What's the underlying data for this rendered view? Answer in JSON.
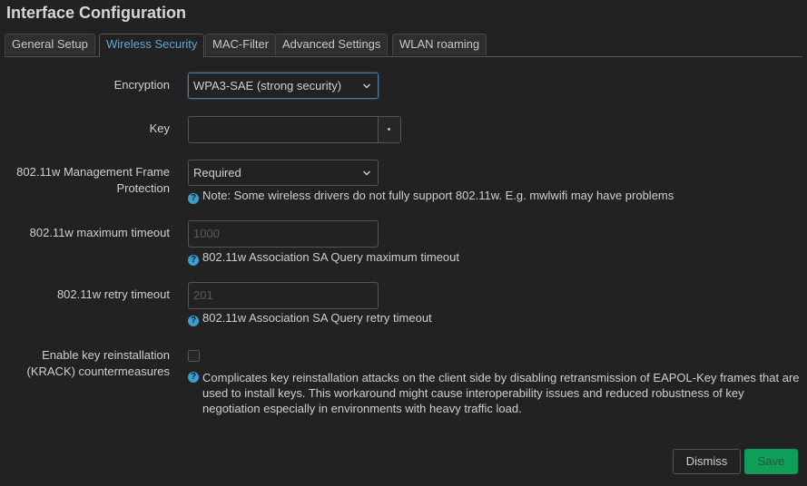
{
  "page": {
    "title": "Interface Configuration"
  },
  "tabs": [
    {
      "label": "General Setup",
      "active": false
    },
    {
      "label": "Wireless Security",
      "active": true
    },
    {
      "label": "MAC-Filter",
      "active": false
    },
    {
      "label": "Advanced Settings",
      "active": false
    },
    {
      "label": "WLAN roaming",
      "active": false
    }
  ],
  "form": {
    "encryption": {
      "label": "Encryption",
      "value": "WPA3-SAE (strong security)"
    },
    "key": {
      "label": "Key",
      "value": "",
      "reveal_button_icon": "dot-icon"
    },
    "mfp": {
      "label_line1": "802.11w Management Frame",
      "label_line2": "Protection",
      "value": "Required",
      "help": "Note: Some wireless drivers do not fully support 802.11w. E.g. mwlwifi may have problems"
    },
    "max_timeout": {
      "label": "802.11w maximum timeout",
      "placeholder": "1000",
      "help": "802.11w Association SA Query maximum timeout"
    },
    "retry_timeout": {
      "label": "802.11w retry timeout",
      "placeholder": "201",
      "help": "802.11w Association SA Query retry timeout"
    },
    "krack": {
      "label_line1": "Enable key reinstallation",
      "label_line2": "(KRACK) countermeasures",
      "checked": false,
      "help": "Complicates key reinstallation attacks on the client side by disabling retransmission of EAPOL-Key frames that are used to install keys. This workaround might cause interoperability issues and reduced robustness of key negotiation especially in environments with heavy traffic load."
    }
  },
  "buttons": {
    "dismiss": "Dismiss",
    "save": "Save"
  },
  "icons": {
    "help": "?"
  },
  "colors": {
    "background": "#222222",
    "accent": "#5fa8d3",
    "help_icon": "#3a9ed1",
    "save": "#0f9d58"
  }
}
